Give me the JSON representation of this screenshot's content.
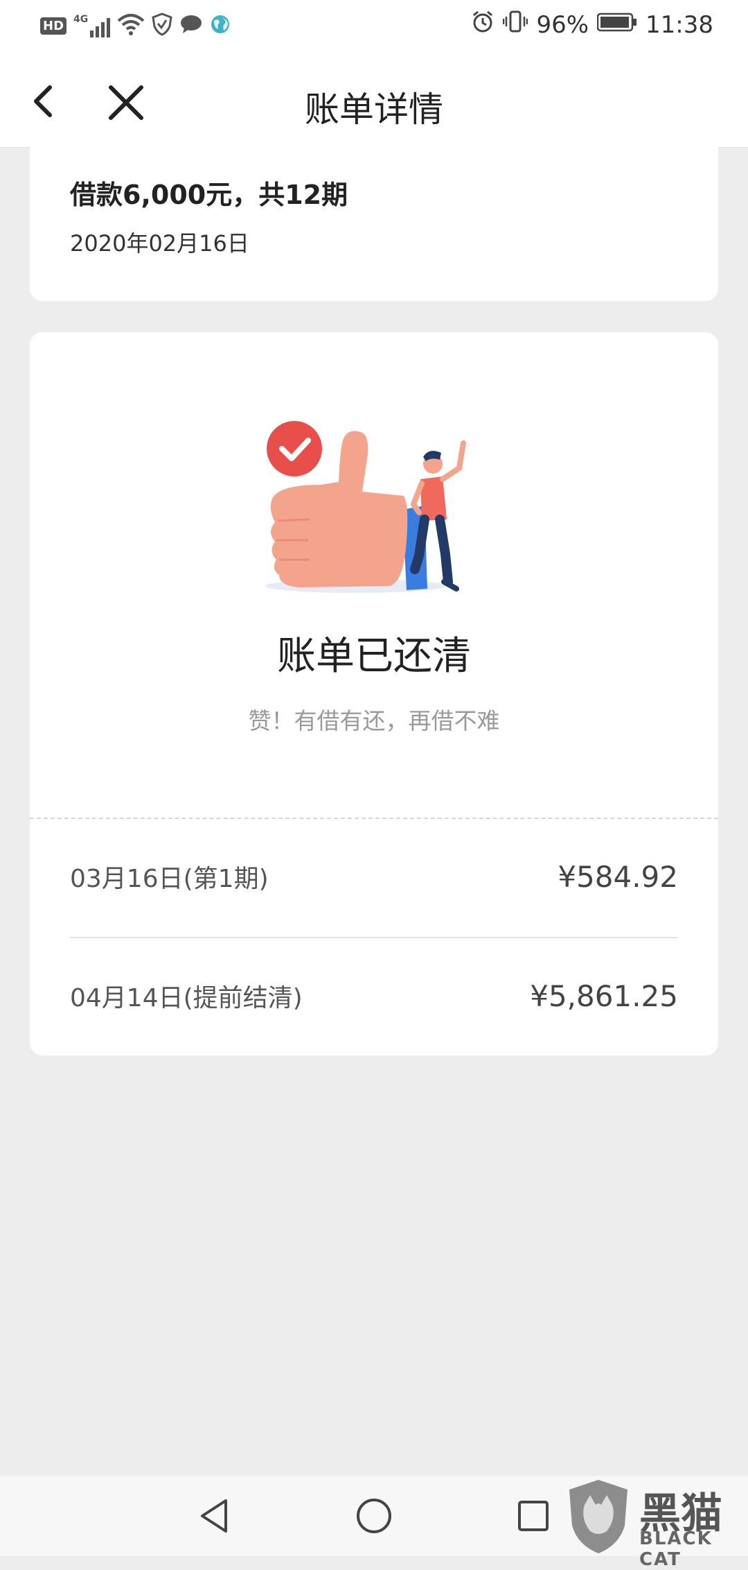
{
  "status_bar": {
    "network_hd": "HD",
    "network_type": "4G",
    "battery": "96%",
    "time": "11:38"
  },
  "header": {
    "title": "账单详情"
  },
  "loan": {
    "summary": "借款6,000元，共12期",
    "date": "2020年02月16日"
  },
  "result": {
    "title": "账单已还清",
    "subtitle": "赞！有借有还，再借不难"
  },
  "payments": [
    {
      "label": "03月16日(第1期)",
      "amount": "¥584.92"
    },
    {
      "label": "04月14日(提前结清)",
      "amount": "¥5,861.25"
    }
  ],
  "watermark": {
    "text": "黑猫",
    "sub": "BLACK CAT"
  },
  "colors": {
    "accent_red": "#e94f4a",
    "hand": "#f4a38c",
    "sleeve": "#3a7de0"
  }
}
